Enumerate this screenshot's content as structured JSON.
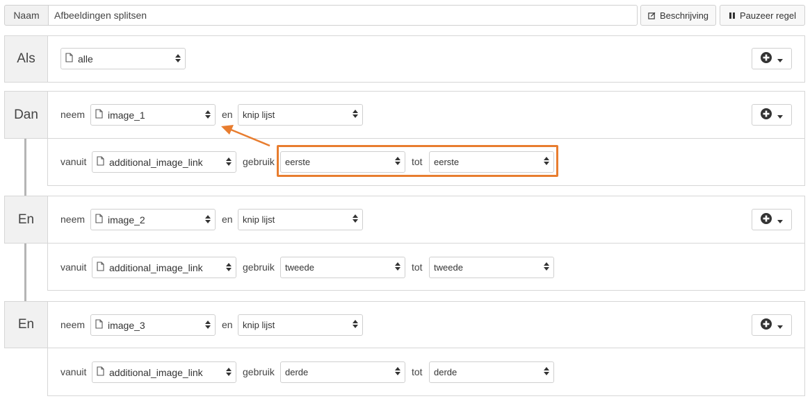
{
  "header": {
    "name_label": "Naam",
    "name_value": "Afbeeldingen splitsen",
    "description_button": "Beschrijving",
    "pause_button": "Pauzeer regel"
  },
  "if_block": {
    "label": "Als",
    "select_value": "alle"
  },
  "then_block": {
    "label": "Dan",
    "take_kw": "neem",
    "field": "image_1",
    "and_kw": "en",
    "action": "knip lijst",
    "from_kw": "vanuit",
    "source": "additional_image_link",
    "use_kw": "gebruik",
    "from_position": "eerste",
    "to_kw": "tot",
    "to_position": "eerste"
  },
  "and_block_1": {
    "label": "En",
    "take_kw": "neem",
    "field": "image_2",
    "and_kw": "en",
    "action": "knip lijst",
    "from_kw": "vanuit",
    "source": "additional_image_link",
    "use_kw": "gebruik",
    "from_position": "tweede",
    "to_kw": "tot",
    "to_position": "tweede"
  },
  "and_block_2": {
    "label": "En",
    "take_kw": "neem",
    "field": "image_3",
    "and_kw": "en",
    "action": "knip lijst",
    "from_kw": "vanuit",
    "source": "additional_image_link",
    "use_kw": "gebruik",
    "from_position": "derde",
    "to_kw": "tot",
    "to_position": "derde"
  },
  "icons": {
    "file": "file-icon",
    "sort": "sort-arrows-icon",
    "add": "plus-circle-icon",
    "caret": "caret-down-icon",
    "edit": "edit-icon",
    "pause": "pause-icon"
  },
  "colors": {
    "highlight": "#e87d2f",
    "label_bg": "#f1f1f1",
    "border": "#d6d6d6"
  }
}
